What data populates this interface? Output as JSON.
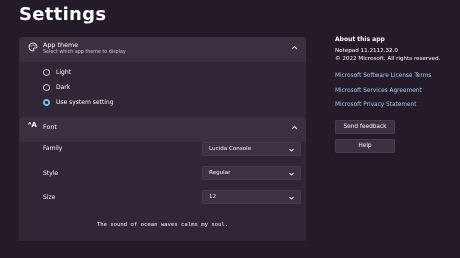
{
  "page": {
    "title": "Settings"
  },
  "app_theme": {
    "title": "App theme",
    "subtitle": "Select which app theme to display",
    "options": [
      {
        "label": "Light",
        "selected": false
      },
      {
        "label": "Dark",
        "selected": false
      },
      {
        "label": "Use system setting",
        "selected": true
      }
    ]
  },
  "font": {
    "title": "Font",
    "family_label": "Family",
    "family_value": "Lucida Console",
    "style_label": "Style",
    "style_value": "Regular",
    "size_label": "Size",
    "size_value": "12",
    "preview": "The sound of ocean waves calms my soul."
  },
  "about": {
    "title": "About this app",
    "version": "Notepad 11.2112.32.0",
    "copyright": "© 2022 Microsoft. All rights reserved.",
    "links": [
      "Microsoft Software License Terms",
      "Microsoft Services Agreement",
      "Microsoft Privacy Statement"
    ],
    "send_feedback": "Send feedback",
    "help": "Help"
  },
  "colors": {
    "accent": "#79c3ea",
    "link": "#9fd1f2",
    "background": "#251b28"
  }
}
